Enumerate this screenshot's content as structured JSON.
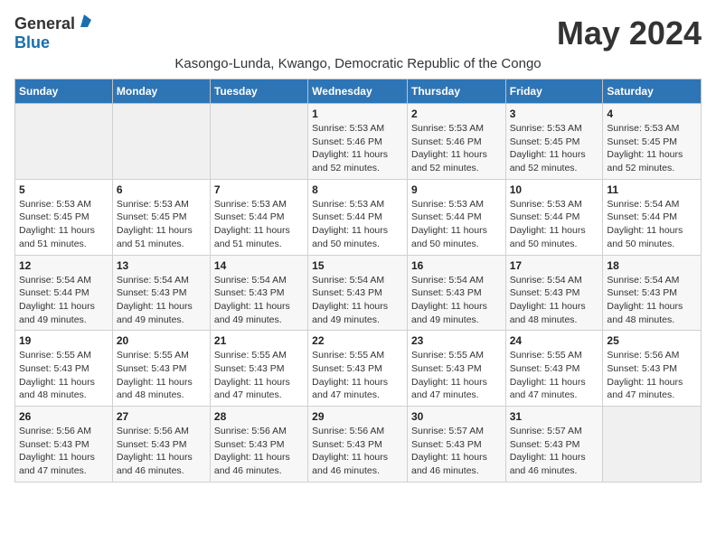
{
  "header": {
    "logo_general": "General",
    "logo_blue": "Blue",
    "month_title": "May 2024",
    "subtitle": "Kasongo-Lunda, Kwango, Democratic Republic of the Congo"
  },
  "days_of_week": [
    "Sunday",
    "Monday",
    "Tuesday",
    "Wednesday",
    "Thursday",
    "Friday",
    "Saturday"
  ],
  "weeks": [
    [
      {
        "day": "",
        "info": ""
      },
      {
        "day": "",
        "info": ""
      },
      {
        "day": "",
        "info": ""
      },
      {
        "day": "1",
        "info": "Sunrise: 5:53 AM\nSunset: 5:46 PM\nDaylight: 11 hours\nand 52 minutes."
      },
      {
        "day": "2",
        "info": "Sunrise: 5:53 AM\nSunset: 5:46 PM\nDaylight: 11 hours\nand 52 minutes."
      },
      {
        "day": "3",
        "info": "Sunrise: 5:53 AM\nSunset: 5:45 PM\nDaylight: 11 hours\nand 52 minutes."
      },
      {
        "day": "4",
        "info": "Sunrise: 5:53 AM\nSunset: 5:45 PM\nDaylight: 11 hours\nand 52 minutes."
      }
    ],
    [
      {
        "day": "5",
        "info": "Sunrise: 5:53 AM\nSunset: 5:45 PM\nDaylight: 11 hours\nand 51 minutes."
      },
      {
        "day": "6",
        "info": "Sunrise: 5:53 AM\nSunset: 5:45 PM\nDaylight: 11 hours\nand 51 minutes."
      },
      {
        "day": "7",
        "info": "Sunrise: 5:53 AM\nSunset: 5:44 PM\nDaylight: 11 hours\nand 51 minutes."
      },
      {
        "day": "8",
        "info": "Sunrise: 5:53 AM\nSunset: 5:44 PM\nDaylight: 11 hours\nand 50 minutes."
      },
      {
        "day": "9",
        "info": "Sunrise: 5:53 AM\nSunset: 5:44 PM\nDaylight: 11 hours\nand 50 minutes."
      },
      {
        "day": "10",
        "info": "Sunrise: 5:53 AM\nSunset: 5:44 PM\nDaylight: 11 hours\nand 50 minutes."
      },
      {
        "day": "11",
        "info": "Sunrise: 5:54 AM\nSunset: 5:44 PM\nDaylight: 11 hours\nand 50 minutes."
      }
    ],
    [
      {
        "day": "12",
        "info": "Sunrise: 5:54 AM\nSunset: 5:44 PM\nDaylight: 11 hours\nand 49 minutes."
      },
      {
        "day": "13",
        "info": "Sunrise: 5:54 AM\nSunset: 5:43 PM\nDaylight: 11 hours\nand 49 minutes."
      },
      {
        "day": "14",
        "info": "Sunrise: 5:54 AM\nSunset: 5:43 PM\nDaylight: 11 hours\nand 49 minutes."
      },
      {
        "day": "15",
        "info": "Sunrise: 5:54 AM\nSunset: 5:43 PM\nDaylight: 11 hours\nand 49 minutes."
      },
      {
        "day": "16",
        "info": "Sunrise: 5:54 AM\nSunset: 5:43 PM\nDaylight: 11 hours\nand 49 minutes."
      },
      {
        "day": "17",
        "info": "Sunrise: 5:54 AM\nSunset: 5:43 PM\nDaylight: 11 hours\nand 48 minutes."
      },
      {
        "day": "18",
        "info": "Sunrise: 5:54 AM\nSunset: 5:43 PM\nDaylight: 11 hours\nand 48 minutes."
      }
    ],
    [
      {
        "day": "19",
        "info": "Sunrise: 5:55 AM\nSunset: 5:43 PM\nDaylight: 11 hours\nand 48 minutes."
      },
      {
        "day": "20",
        "info": "Sunrise: 5:55 AM\nSunset: 5:43 PM\nDaylight: 11 hours\nand 48 minutes."
      },
      {
        "day": "21",
        "info": "Sunrise: 5:55 AM\nSunset: 5:43 PM\nDaylight: 11 hours\nand 47 minutes."
      },
      {
        "day": "22",
        "info": "Sunrise: 5:55 AM\nSunset: 5:43 PM\nDaylight: 11 hours\nand 47 minutes."
      },
      {
        "day": "23",
        "info": "Sunrise: 5:55 AM\nSunset: 5:43 PM\nDaylight: 11 hours\nand 47 minutes."
      },
      {
        "day": "24",
        "info": "Sunrise: 5:55 AM\nSunset: 5:43 PM\nDaylight: 11 hours\nand 47 minutes."
      },
      {
        "day": "25",
        "info": "Sunrise: 5:56 AM\nSunset: 5:43 PM\nDaylight: 11 hours\nand 47 minutes."
      }
    ],
    [
      {
        "day": "26",
        "info": "Sunrise: 5:56 AM\nSunset: 5:43 PM\nDaylight: 11 hours\nand 47 minutes."
      },
      {
        "day": "27",
        "info": "Sunrise: 5:56 AM\nSunset: 5:43 PM\nDaylight: 11 hours\nand 46 minutes."
      },
      {
        "day": "28",
        "info": "Sunrise: 5:56 AM\nSunset: 5:43 PM\nDaylight: 11 hours\nand 46 minutes."
      },
      {
        "day": "29",
        "info": "Sunrise: 5:56 AM\nSunset: 5:43 PM\nDaylight: 11 hours\nand 46 minutes."
      },
      {
        "day": "30",
        "info": "Sunrise: 5:57 AM\nSunset: 5:43 PM\nDaylight: 11 hours\nand 46 minutes."
      },
      {
        "day": "31",
        "info": "Sunrise: 5:57 AM\nSunset: 5:43 PM\nDaylight: 11 hours\nand 46 minutes."
      },
      {
        "day": "",
        "info": ""
      }
    ]
  ]
}
